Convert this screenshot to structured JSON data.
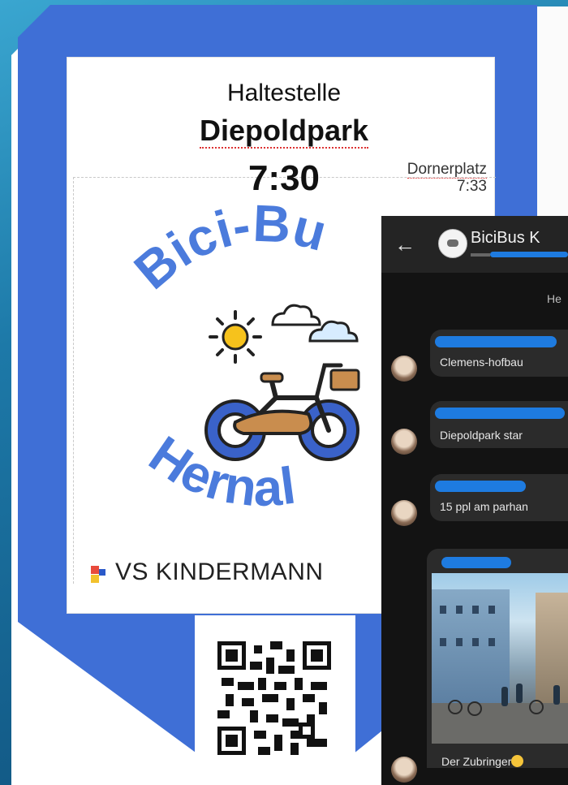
{
  "poster": {
    "stop_header": "Haltestelle",
    "stop_name": "Diepoldpark",
    "time": "7:30",
    "next_stop_name": "Dornerplatz",
    "next_stop_time": "7:33",
    "logo_top_text": "Bici-Bu",
    "logo_bottom_text": "Hernal",
    "school": "VS KINDERMANN",
    "colors": {
      "accent": "#3f6fd6",
      "logo_text": "#4b7bdc"
    }
  },
  "chat": {
    "title": "BiciBus K",
    "day_label": "He",
    "messages": [
      {
        "text": "Clemens-hofbau"
      },
      {
        "text": "Diepoldpark star"
      },
      {
        "text": "15 ppl am parhan"
      }
    ],
    "last_message": "Der Zubringer",
    "icons": {
      "back": "back-arrow-icon",
      "emoji": "smile-emoji-icon"
    }
  }
}
